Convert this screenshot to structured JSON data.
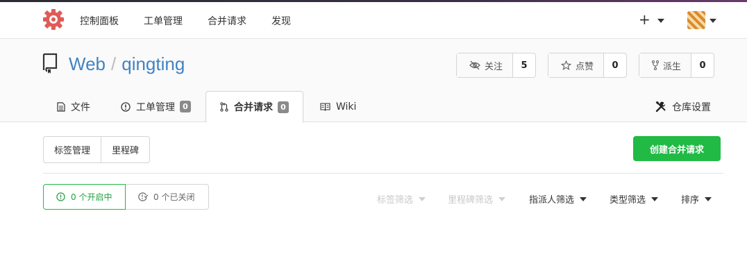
{
  "nav": {
    "items": [
      "控制面板",
      "工单管理",
      "合并请求",
      "发现"
    ],
    "plus": "+"
  },
  "repo": {
    "owner": "Web",
    "separator": "/",
    "name": "qingting",
    "watch": {
      "label": "关注",
      "count": "5"
    },
    "star": {
      "label": "点赞",
      "count": "0"
    },
    "fork": {
      "label": "派生",
      "count": "0"
    }
  },
  "tabs": {
    "files": "文件",
    "issues": {
      "label": "工单管理",
      "count": "0"
    },
    "pulls": {
      "label": "合并请求",
      "count": "0"
    },
    "wiki": "Wiki",
    "settings": "仓库设置"
  },
  "toolbar": {
    "labels": "标签管理",
    "milestones": "里程碑",
    "create": "创建合并请求"
  },
  "states": {
    "open": "0 个开启中",
    "closed": "0 个已关闭"
  },
  "filters": {
    "label": "标签筛选",
    "milestone": "里程碑筛选",
    "assignee": "指派人筛选",
    "type": "类型筛选",
    "sort": "排序"
  },
  "colors": {
    "accent_green": "#21ba45",
    "link_blue": "#4183c4",
    "logo_red": "#e05b57"
  }
}
